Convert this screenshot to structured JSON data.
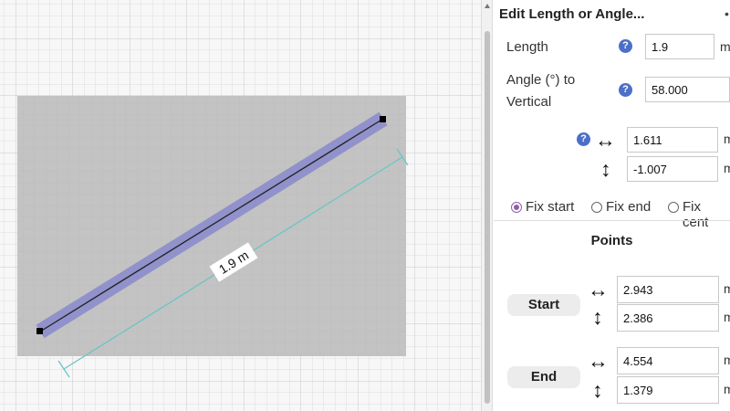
{
  "dialog": {
    "title": "Edit Length or Angle...",
    "title_trailing": "•"
  },
  "length": {
    "label": "Length",
    "value": "1.9",
    "unit": "m"
  },
  "angle": {
    "label_line1": "Angle (°) to",
    "label_line2": "Vertical",
    "value": "58.000"
  },
  "components": {
    "dx": {
      "value": "1.611",
      "unit": "m"
    },
    "dy": {
      "value": "-1.007",
      "unit": "m"
    }
  },
  "fix_options": [
    {
      "label": "Fix start",
      "checked": true
    },
    {
      "label": "Fix end",
      "checked": false
    },
    {
      "label": "Fix cent",
      "checked": false
    }
  ],
  "points": {
    "title": "Points",
    "start": {
      "label": "Start",
      "x": "2.943",
      "y": "2.386",
      "unit": "m"
    },
    "end": {
      "label": "End",
      "x": "4.554",
      "y": "1.379",
      "unit": "m"
    }
  },
  "canvas": {
    "dimension_label": "1.9 m",
    "segment_color": "#8f8fcc",
    "rect_color": "#c3c3c3",
    "dimension_color": "#6cc4c4"
  },
  "icons": {
    "help": "?",
    "horizontal": "↔",
    "vertical": "↕"
  }
}
